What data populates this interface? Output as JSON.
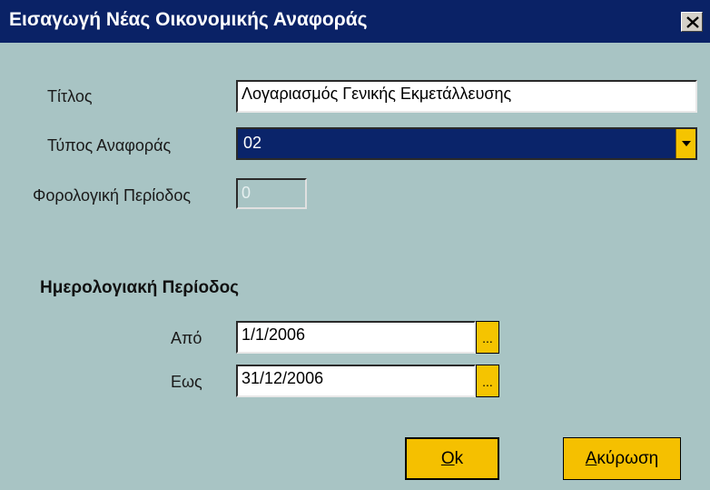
{
  "window": {
    "title": "Εισαγωγή Νέας Οικονομικής Αναφοράς",
    "close_icon": "close-icon"
  },
  "form": {
    "title_label": "Τίτλος",
    "title_value": "Λογαριασμός Γενικής Εκμετάλλευσης",
    "type_label": "Τύπος Αναφοράς",
    "type_value": "02",
    "tax_period_label": "Φορολογική Περίοδος",
    "tax_period_value": "0"
  },
  "calendar": {
    "heading": "Ημερολογιακή Περίοδος",
    "from_label": "Από",
    "from_value": "1/1/2006",
    "to_label": "Εως",
    "to_value": "31/12/2006",
    "picker_label": "..."
  },
  "buttons": {
    "ok_first": "O",
    "ok_rest": "k",
    "cancel_first": "Α",
    "cancel_rest": "κύρωση"
  },
  "colors": {
    "background": "#a8c4c4",
    "titlebar": "#0a2266",
    "accent": "#f5c400",
    "selection": "#0a246a"
  }
}
